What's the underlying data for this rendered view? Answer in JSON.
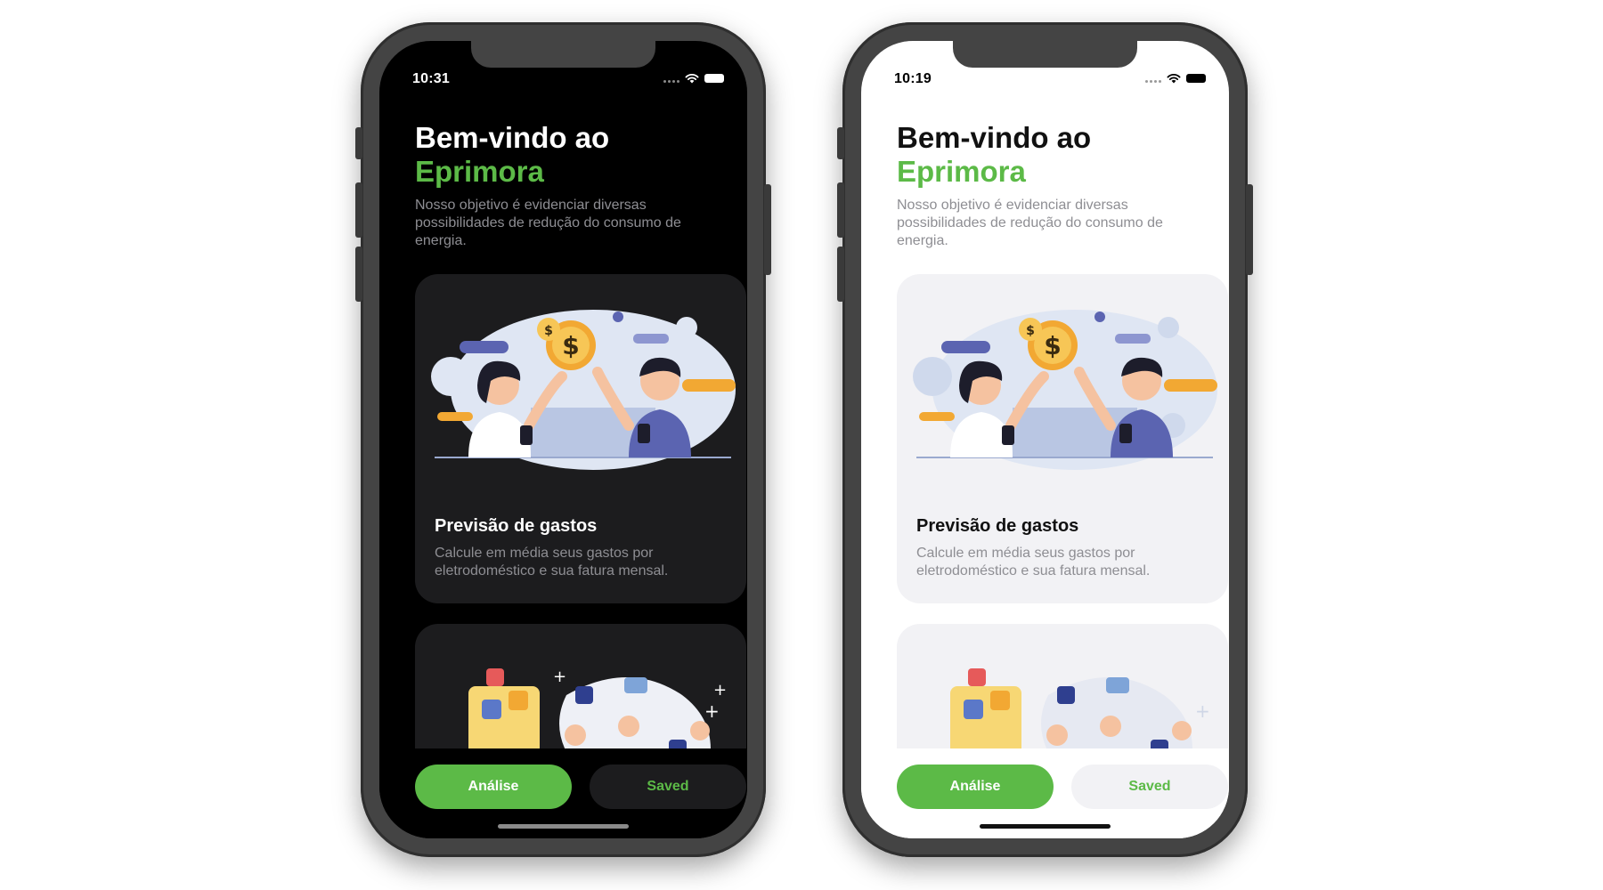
{
  "theme": {
    "accent": "#5cba47",
    "dark_background": "#000000",
    "dark_card": "#1c1c1e",
    "light_background": "#ffffff",
    "light_card": "#f2f2f5",
    "secondary_text": "#8e8e93"
  },
  "phones": [
    {
      "mode": "dark",
      "status_time": "10:31",
      "title_line1": "Bem-vindo ao",
      "title_brand": "Eprimora",
      "subtitle": "Nosso objetivo é evidenciar diversas possibilidades de redução do consumo de energia.",
      "card1_title": "Previsão de gastos",
      "card1_desc": "Calcule em média seus gastos por eletrodoméstico e sua fatura mensal.",
      "btn_analise": "Análise",
      "btn_saved": "Saved",
      "icons": [
        "wifi-icon",
        "battery-icon"
      ]
    },
    {
      "mode": "light",
      "status_time": "10:19",
      "title_line1": "Bem-vindo ao",
      "title_brand": "Eprimora",
      "subtitle": "Nosso objetivo é evidenciar diversas possibilidades de redução do consumo de energia.",
      "card1_title": "Previsão de gastos",
      "card1_desc": "Calcule em média seus gastos por eletrodoméstico e sua fatura mensal.",
      "btn_analise": "Análise",
      "btn_saved": "Saved",
      "icons": [
        "wifi-icon",
        "battery-icon"
      ]
    }
  ]
}
